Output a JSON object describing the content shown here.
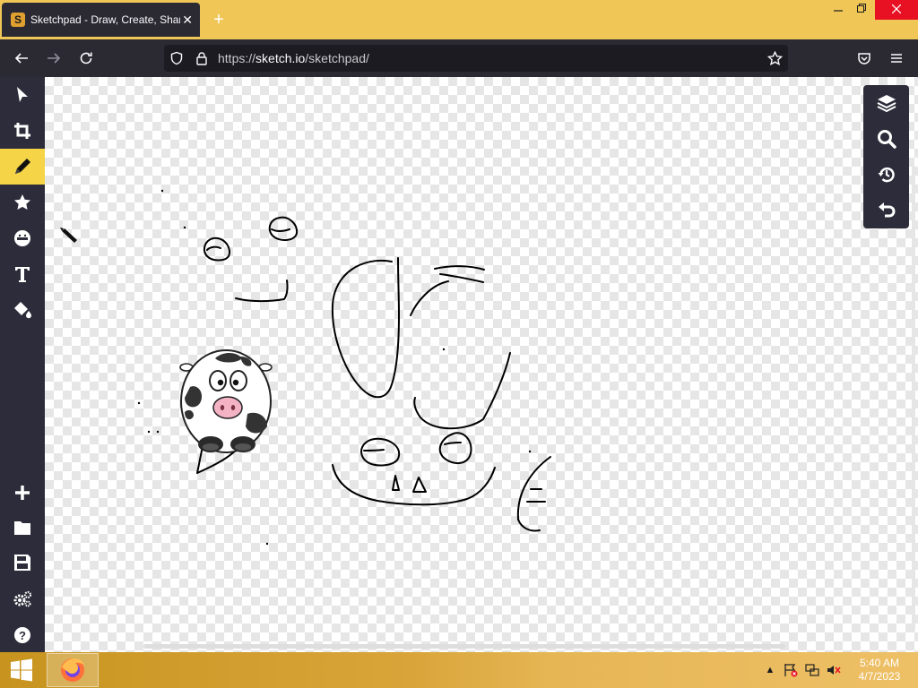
{
  "browser": {
    "tab_title": "Sketchpad - Draw, Create, Share!",
    "favicon_letter": "S",
    "new_tab_icon": "plus-icon",
    "url_scheme": "https://",
    "url_host": "sketch.io",
    "url_path": "/sketchpad/",
    "window_controls": [
      "minimize-icon",
      "restore-icon",
      "close-icon"
    ]
  },
  "toolbar": {
    "tools": [
      {
        "name": "select",
        "icon": "cursor-arrow-icon",
        "active": false
      },
      {
        "name": "crop",
        "icon": "crop-icon",
        "active": false
      },
      {
        "name": "pencil",
        "icon": "pencil-icon",
        "active": true
      },
      {
        "name": "stamp",
        "icon": "star-icon",
        "active": false
      },
      {
        "name": "emoji",
        "icon": "emoji-face-icon",
        "active": false
      },
      {
        "name": "text",
        "icon": "text-icon",
        "active": false
      },
      {
        "name": "fill",
        "icon": "paint-bucket-icon",
        "active": false
      }
    ],
    "bottom_tools": [
      {
        "name": "new",
        "icon": "plus-icon"
      },
      {
        "name": "open",
        "icon": "folder-icon"
      },
      {
        "name": "save",
        "icon": "save-icon"
      },
      {
        "name": "settings",
        "icon": "gears-icon"
      },
      {
        "name": "help",
        "icon": "help-icon"
      }
    ]
  },
  "right_panel": {
    "tools": [
      {
        "name": "layers",
        "icon": "layers-icon"
      },
      {
        "name": "zoom",
        "icon": "zoom-icon"
      },
      {
        "name": "history",
        "icon": "history-icon"
      },
      {
        "name": "undo",
        "icon": "undo-icon"
      }
    ]
  },
  "taskbar": {
    "time": "5:40 AM",
    "date": "4/7/2023",
    "tray_icons": [
      "show-hidden-icons-icon",
      "action-center-flag-icon",
      "network-icon",
      "volume-muted-icon"
    ]
  }
}
